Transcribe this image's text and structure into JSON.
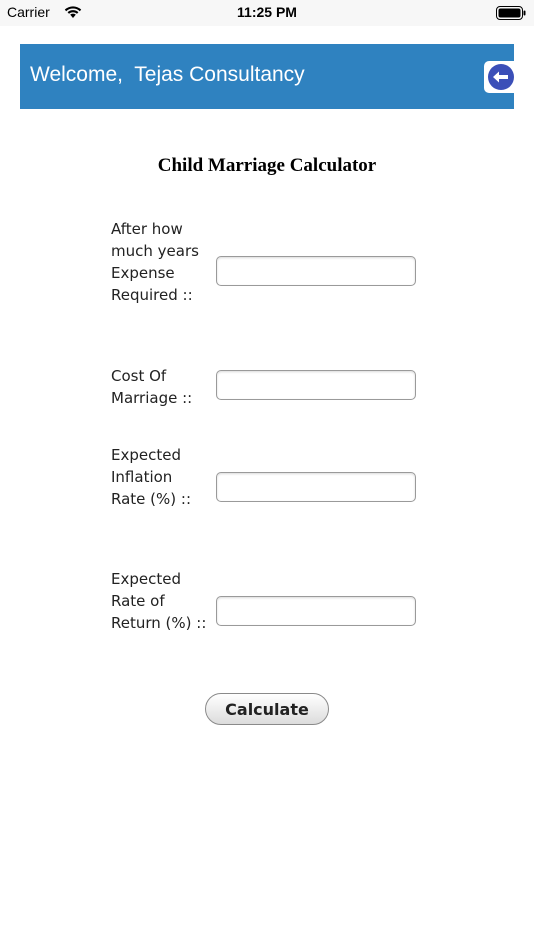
{
  "status_bar": {
    "carrier": "Carrier",
    "time": "11:25 PM",
    "icons": [
      "wifi-icon",
      "battery-icon"
    ]
  },
  "header": {
    "title": "Welcome,  Tejas Consultancy",
    "back_icon": "back-arrow-icon",
    "bg_color": "#2f82c0",
    "icon_color": "#3b4fb8"
  },
  "form": {
    "title": "Child Marriage Calculator",
    "fields": [
      {
        "label": "After how much years Expense Required ::",
        "value": "",
        "placeholder": ""
      },
      {
        "label": "Cost Of Marriage ::",
        "value": "",
        "placeholder": ""
      },
      {
        "label": "Expected Inflation Rate (%) ::",
        "value": "",
        "placeholder": ""
      },
      {
        "label": "Expected Rate of Return (%) ::",
        "value": "",
        "placeholder": ""
      }
    ],
    "submit_label": "Calculate"
  }
}
